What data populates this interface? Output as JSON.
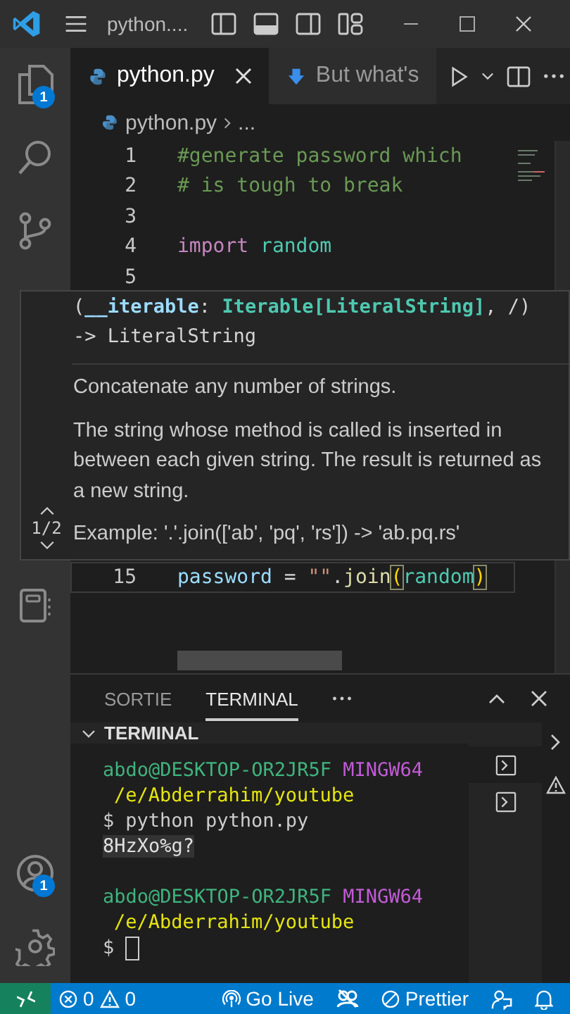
{
  "title_bar": {
    "title": "python...."
  },
  "activity_bar": {
    "items": [
      {
        "kind": "files",
        "badge": "1"
      },
      {
        "kind": "search"
      },
      {
        "kind": "scm"
      },
      {
        "kind": "notebook"
      },
      {
        "kind": "account",
        "badge": "1"
      },
      {
        "kind": "settings"
      }
    ]
  },
  "tabs": [
    {
      "label": "python.py",
      "selected": true,
      "kind": "python"
    },
    {
      "label": "But what's",
      "selected": false,
      "kind": "download"
    }
  ],
  "breadcrumb": {
    "file": "python.py",
    "rest": "..."
  },
  "editor": {
    "lines": [
      {
        "number": "1",
        "current": false,
        "tokens": [
          {
            "text": "#generate password which",
            "kind": "comment"
          }
        ]
      },
      {
        "number": "2",
        "current": false,
        "tokens": [
          {
            "text": "# is tough to break",
            "kind": "comment"
          }
        ]
      },
      {
        "number": "3",
        "current": false
      },
      {
        "number": "4",
        "current": false,
        "tokens": [
          {
            "text": "import ",
            "kind": "keyword"
          },
          {
            "text": "random",
            "kind": "module"
          }
        ]
      },
      {
        "number": "5",
        "current": false
      },
      {
        "number": "15",
        "current": true,
        "tokens": [
          {
            "text": "password",
            "kind": "variable"
          },
          {
            "text": " = ",
            "kind": "plain"
          },
          {
            "text": "\"\"",
            "kind": "string"
          },
          {
            "text": ".",
            "kind": "plain"
          },
          {
            "text": "join",
            "kind": "function"
          },
          {
            "text": "(",
            "kind": "bracket"
          },
          {
            "text": "random",
            "kind": "module"
          },
          {
            "text": ")",
            "kind": "bracket"
          }
        ]
      }
    ]
  },
  "hover": {
    "page": "1/2",
    "signature": [
      [
        {
          "text": "(",
          "kind": "plain"
        },
        {
          "text": "__iterable",
          "kind": "param"
        },
        {
          "text": ": ",
          "kind": "plain"
        },
        {
          "text": "Iterable[LiteralString]",
          "kind": "type"
        },
        {
          "text": ", /)",
          "kind": "plain"
        }
      ],
      [
        {
          "text": "-> LiteralString",
          "kind": "plain"
        }
      ]
    ],
    "paragraphs": [
      "Concatenate any number of strings.",
      "The string whose method is called is inserted in between each given string. The result is returned as a new string.",
      "Example: '.'.join(['ab', 'pq', 'rs']) -> 'ab.pq.rs'"
    ]
  },
  "panel": {
    "tabs": [
      {
        "label": "SORTIE",
        "selected": false
      },
      {
        "label": "TERMINAL",
        "selected": true
      }
    ],
    "section": "TERMINAL"
  },
  "terminal": {
    "blocks": [
      {
        "user": "abdo@DESKTOP-OR2JR5F",
        "host": "MINGW64",
        "path": "/e/Abderrahim/youtube",
        "prompt": "$",
        "command": "python python.py",
        "output": "8HzXo%g?",
        "cursor": false
      },
      {
        "user": "abdo@DESKTOP-OR2JR5F",
        "host": "MINGW64",
        "path": "/e/Abderrahim/youtube",
        "prompt": "$",
        "cursor": true
      }
    ]
  },
  "status_bar": {
    "errors": "0",
    "warnings": "0",
    "items": [
      {
        "kind": "golive",
        "label": "Go Live"
      },
      {
        "kind": "accounts"
      },
      {
        "kind": "prettier",
        "label": "Prettier"
      },
      {
        "kind": "feedback"
      },
      {
        "kind": "bell"
      }
    ]
  }
}
